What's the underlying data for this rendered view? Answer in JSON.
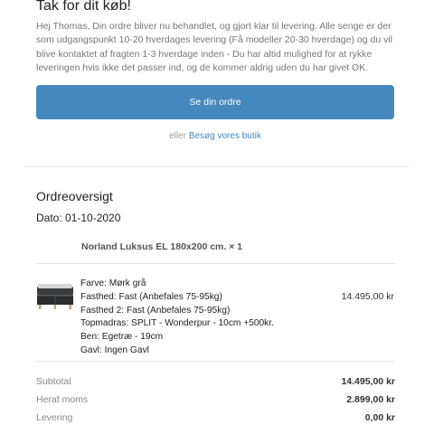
{
  "header": {
    "title": "Tak for dit køb!",
    "intro": "Hej Thomas, Din ordre bliver nu behandlet, og gjort klar til levering. Alle senge er der som udgangspunkt 10-20 hverdages levering (Få modeller 20-30 hverdage) og du vil blive kontaktet af fragten 1-3 hverdage inden - Du har altid mulighed for at rykke leveringen hvis ikke det passer ind, og de kommer aldrig uden du har givet OK.",
    "view_order_button": "Se din ordre",
    "or_text": "eller",
    "visit_store_link": "Besøg vores butik"
  },
  "order": {
    "title": "Ordreoversigt",
    "date": "Dato: 01-10-2020",
    "product_name": "Norland Luksus EL 180x200 cm. × 1",
    "attributes": [
      "Farve: Mørk grå",
      "Fasthed: Fast (Anbefales 75-95kg)",
      "Fasthed 2: Fast (Anbefales 75-95kg)",
      "Topmadras: SPLIT - Wonderpur - 10cm +500kr.",
      "Ben: Egetræ - 19cm",
      "Gavl: Ingen Gavl"
    ],
    "line_price": "14.495,00 kr",
    "product_image": "bed-product-thumbnail"
  },
  "summary": [
    {
      "label": "Subtotal",
      "value": "14.495,00 kr"
    },
    {
      "label": "Heraf moms",
      "value": "2.899,00 kr"
    },
    {
      "label": "Levering",
      "value": "0,00 kr"
    }
  ],
  "colors": {
    "accent": "#4588bd",
    "muted_text": "#777777",
    "divider": "#e5e5e5"
  }
}
